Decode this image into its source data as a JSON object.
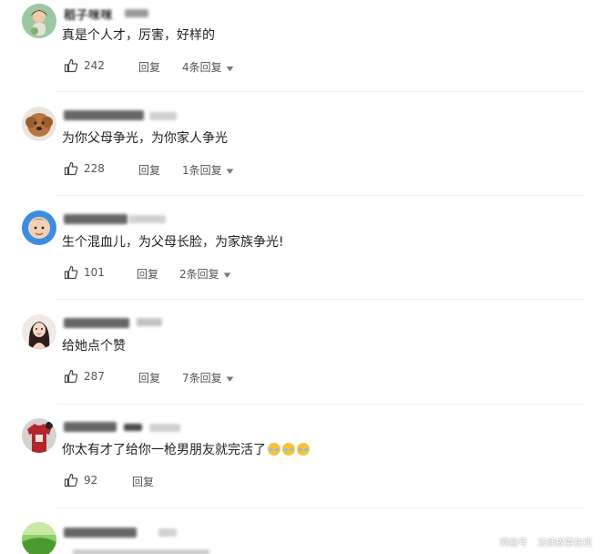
{
  "comments": [
    {
      "username": "稻子咪咪",
      "text": "真是个人才，厉害，好样的",
      "likes": "242",
      "reply_label": "回复",
      "more_replies": "4条回复",
      "avatar_icon": "girl-avatar-icon"
    },
    {
      "username": "",
      "text": "为你父母争光，为你家人争光",
      "likes": "228",
      "reply_label": "回复",
      "more_replies": "1条回复",
      "avatar_icon": "dog-avatar-icon"
    },
    {
      "username": "",
      "text": "生个混血儿，为父母长脸，为家族争光!",
      "likes": "101",
      "reply_label": "回复",
      "more_replies": "2条回复",
      "avatar_icon": "baby-avatar-icon"
    },
    {
      "username": "",
      "text": "给她点个赞",
      "likes": "287",
      "reply_label": "回复",
      "more_replies": "7条回复",
      "avatar_icon": "woman-avatar-icon"
    },
    {
      "username": "",
      "text": "你太有才了给你一枪男朋友就完活了",
      "likes": "92",
      "reply_label": "回复",
      "more_replies": "",
      "avatar_icon": "jersey-avatar-icon"
    },
    {
      "username": "",
      "text": "",
      "likes": "",
      "reply_label": "",
      "more_replies": "",
      "avatar_icon": "landscape-avatar-icon"
    }
  ],
  "watermark": {
    "left": "网易号",
    "right": "法律故事在线"
  },
  "colors": {
    "text": "#222222",
    "meta": "#555555",
    "divider": "#ececec"
  }
}
